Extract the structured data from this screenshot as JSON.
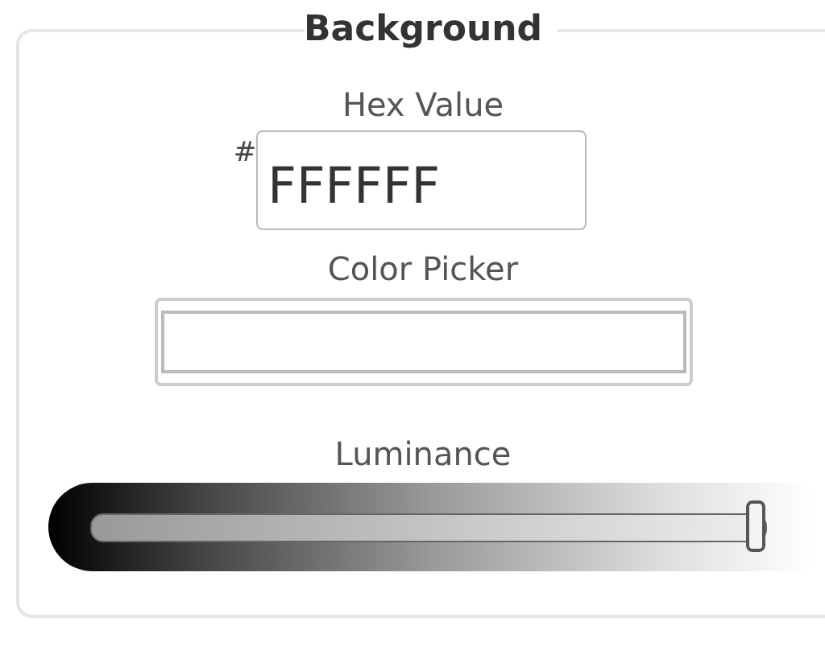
{
  "panel": {
    "title": "Background"
  },
  "hex": {
    "label": "Hex Value",
    "prefix": "#",
    "value": "FFFFFF"
  },
  "picker": {
    "label": "Color Picker",
    "color": "#ffffff"
  },
  "luminance": {
    "label": "Luminance",
    "level": 0.985
  }
}
